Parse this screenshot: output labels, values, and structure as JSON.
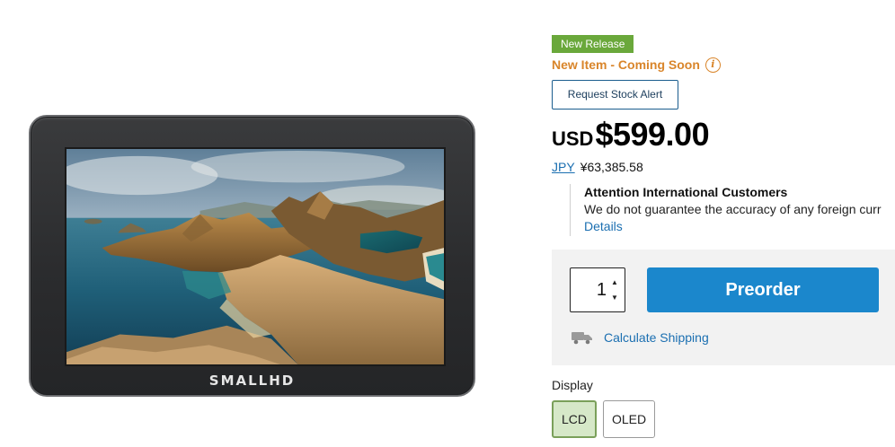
{
  "product_image": {
    "brand": "SMALLHD",
    "screen_scene": "coastal-landscape"
  },
  "status": {
    "badge": "New Release",
    "badge_color": "#6aa83b",
    "availability": "New Item - Coming Soon",
    "availability_color": "#d9852a",
    "info_icon": "info-icon"
  },
  "stock_alert": {
    "label": "Request Stock Alert"
  },
  "price": {
    "currency": "USD",
    "amount": "$599.00",
    "alt_currency_code": "JPY",
    "alt_amount": "¥63,385.58"
  },
  "notice": {
    "title": "Attention International Customers",
    "body": "We do not guarantee the accuracy of any foreign curr",
    "link": "Details"
  },
  "buy_box": {
    "quantity": "1",
    "up_icon": "chevron-up-icon",
    "down_icon": "chevron-down-icon",
    "cta": "Preorder",
    "cta_color": "#1b87cc",
    "shipping_icon": "truck-icon",
    "shipping_link": "Calculate Shipping"
  },
  "display_option": {
    "label": "Display",
    "options": [
      "LCD",
      "OLED"
    ],
    "selected": "LCD"
  }
}
